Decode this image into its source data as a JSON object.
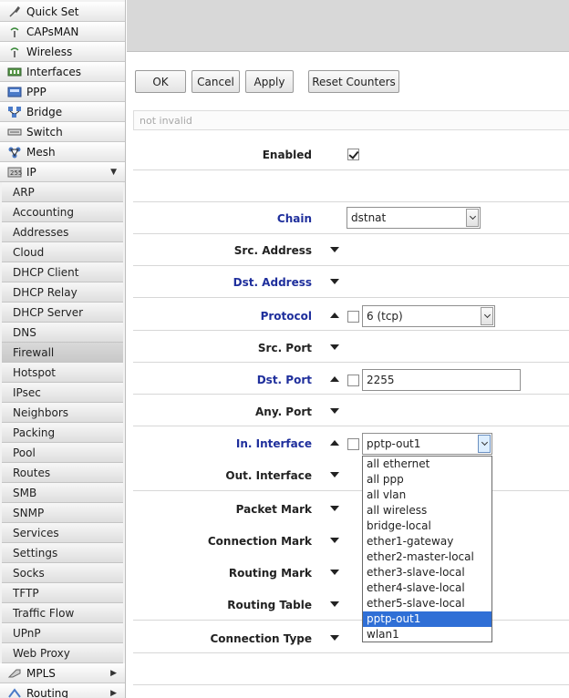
{
  "sidebar": {
    "top_items": [
      {
        "label": "Quick Set",
        "icon": "quick-set-icon"
      },
      {
        "label": "CAPsMAN",
        "icon": "capsman-icon"
      },
      {
        "label": "Wireless",
        "icon": "wireless-icon"
      },
      {
        "label": "Interfaces",
        "icon": "interfaces-icon"
      },
      {
        "label": "PPP",
        "icon": "ppp-icon"
      },
      {
        "label": "Bridge",
        "icon": "bridge-icon"
      },
      {
        "label": "Switch",
        "icon": "switch-icon"
      },
      {
        "label": "Mesh",
        "icon": "mesh-icon"
      },
      {
        "label": "IP",
        "icon": "ip-icon",
        "expanded": true
      }
    ],
    "ip_sub_items": [
      "ARP",
      "Accounting",
      "Addresses",
      "Cloud",
      "DHCP Client",
      "DHCP Relay",
      "DHCP Server",
      "DNS",
      "Firewall",
      "Hotspot",
      "IPsec",
      "Neighbors",
      "Packing",
      "Pool",
      "Routes",
      "SMB",
      "SNMP",
      "Services",
      "Settings",
      "Socks",
      "TFTP",
      "Traffic Flow",
      "UPnP",
      "Web Proxy"
    ],
    "active_sub_item": "Firewall",
    "bottom_items": [
      {
        "label": "MPLS",
        "icon": "mpls-icon"
      },
      {
        "label": "Routing",
        "icon": "routing-icon"
      }
    ]
  },
  "toolbar": {
    "ok": "OK",
    "cancel": "Cancel",
    "apply": "Apply",
    "reset_counters": "Reset Counters"
  },
  "status": {
    "text": "not invalid"
  },
  "form": {
    "enabled": {
      "label": "Enabled",
      "checked": true
    },
    "chain": {
      "label": "Chain",
      "value": "dstnat"
    },
    "src_address": {
      "label": "Src. Address"
    },
    "dst_address": {
      "label": "Dst. Address"
    },
    "protocol": {
      "label": "Protocol",
      "value": "6 (tcp)",
      "negate": false
    },
    "src_port": {
      "label": "Src. Port"
    },
    "dst_port": {
      "label": "Dst. Port",
      "value": "2255",
      "negate": false
    },
    "any_port": {
      "label": "Any. Port"
    },
    "in_interface": {
      "label": "In. Interface",
      "value": "pptp-out1",
      "negate": false
    },
    "out_interface": {
      "label": "Out. Interface"
    },
    "packet_mark": {
      "label": "Packet Mark"
    },
    "connection_mark": {
      "label": "Connection Mark"
    },
    "routing_mark": {
      "label": "Routing Mark"
    },
    "routing_table": {
      "label": "Routing Table"
    },
    "connection_type": {
      "label": "Connection Type"
    }
  },
  "interface_dropdown": {
    "options": [
      "all ethernet",
      "all ppp",
      "all vlan",
      "all wireless",
      "bridge-local",
      "ether1-gateway",
      "ether2-master-local",
      "ether3-slave-local",
      "ether4-slave-local",
      "ether5-slave-local",
      "pptp-out1",
      "wlan1"
    ],
    "selected": "pptp-out1"
  },
  "colors": {
    "label_blue": "#1f2f9c",
    "selection_blue": "#2f6fd6",
    "header_gray": "#d8d8d8"
  }
}
